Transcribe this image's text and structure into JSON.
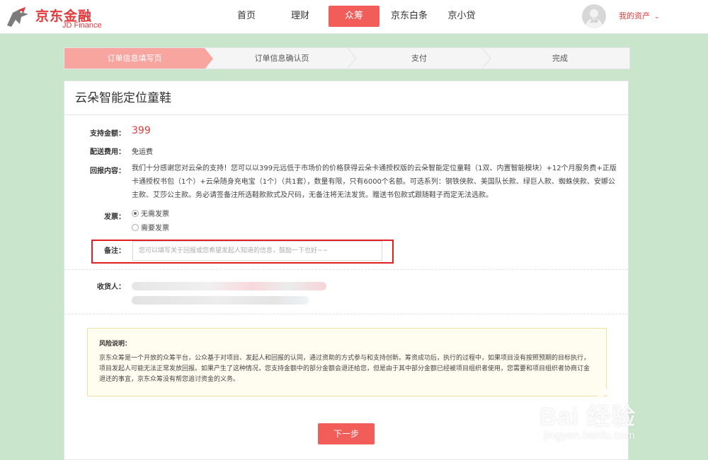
{
  "header": {
    "logo_cn": "京东金融",
    "logo_en": "JD Finance",
    "nav": [
      {
        "label": "首页",
        "active": false
      },
      {
        "label": "理财",
        "active": false
      },
      {
        "label": "众筹",
        "active": true
      },
      {
        "label": "京东白条",
        "active": false
      },
      {
        "label": "京小贷",
        "active": false
      }
    ],
    "avatar_number": "209",
    "my_assets": "我的资产"
  },
  "steps": [
    {
      "label": "订单信息填写页",
      "active": true
    },
    {
      "label": "订单信息确认页",
      "active": false
    },
    {
      "label": "支付",
      "active": false
    },
    {
      "label": "完成",
      "active": false
    }
  ],
  "product": {
    "title": "云朵智能定位童鞋",
    "support_amount_label": "支持金额：",
    "support_amount": "399",
    "shipping_label": "配送费用：",
    "shipping_value": "免运费",
    "reward_label": "回报内容：",
    "reward_text": "我们十分感谢您对云朵的支持！您可以以399元远低于市场价的价格获得云朵卡通授权版的云朵智能定位童鞋（1双、内置智能模块）+12个月服务费+正版卡通授权书包（1个）+云朵随身充电宝（1个）（共1套），数量有限，只有6000个名额。可选系列：钢铁侠款、美国队长款、绿巨人款、蜘蛛侠款、安娜公主款、艾莎公主款。务必请签备注所选鞋款款式及尺码，无备注将无法发货。赠送书包款式跟随鞋子而定无法选款。",
    "invoice_label": "发票：",
    "invoice_options": [
      {
        "label": "无需发票",
        "checked": true
      },
      {
        "label": "需要发票",
        "checked": false
      }
    ],
    "remark_label": "备注：",
    "remark_placeholder": "您可以填写关于回报或您希望发起人知道的信息，鼓励一下也好~~",
    "remark_value": "",
    "receiver_label": "收货人："
  },
  "risk": {
    "title": "风险说明：",
    "text": "京东众筹是一个开放的众筹平台，公众基于对项目、发起人和回报的认同，通过资助的方式参与和支持创新。筹资成功后，执行的过程中，如果项目没有按照预期的目标执行，项目发起人可能无法正常发放回报。如果产生了这种情况，您支持金额中的部分金额会退还给您，但是由于其中部分金额已经被项目组织者使用，您需要和项目组织者协商订金退还的事宜，京东众筹没有帮您追讨资金的义务。"
  },
  "next_button": "下一步",
  "watermark": {
    "text": "Bai 经验",
    "url": "jingyan.baidu.com"
  },
  "colors": {
    "accent": "#f25d5a",
    "brand": "#e4393c",
    "step_active": "#f8a5a0",
    "background": "#c9e6cd"
  }
}
